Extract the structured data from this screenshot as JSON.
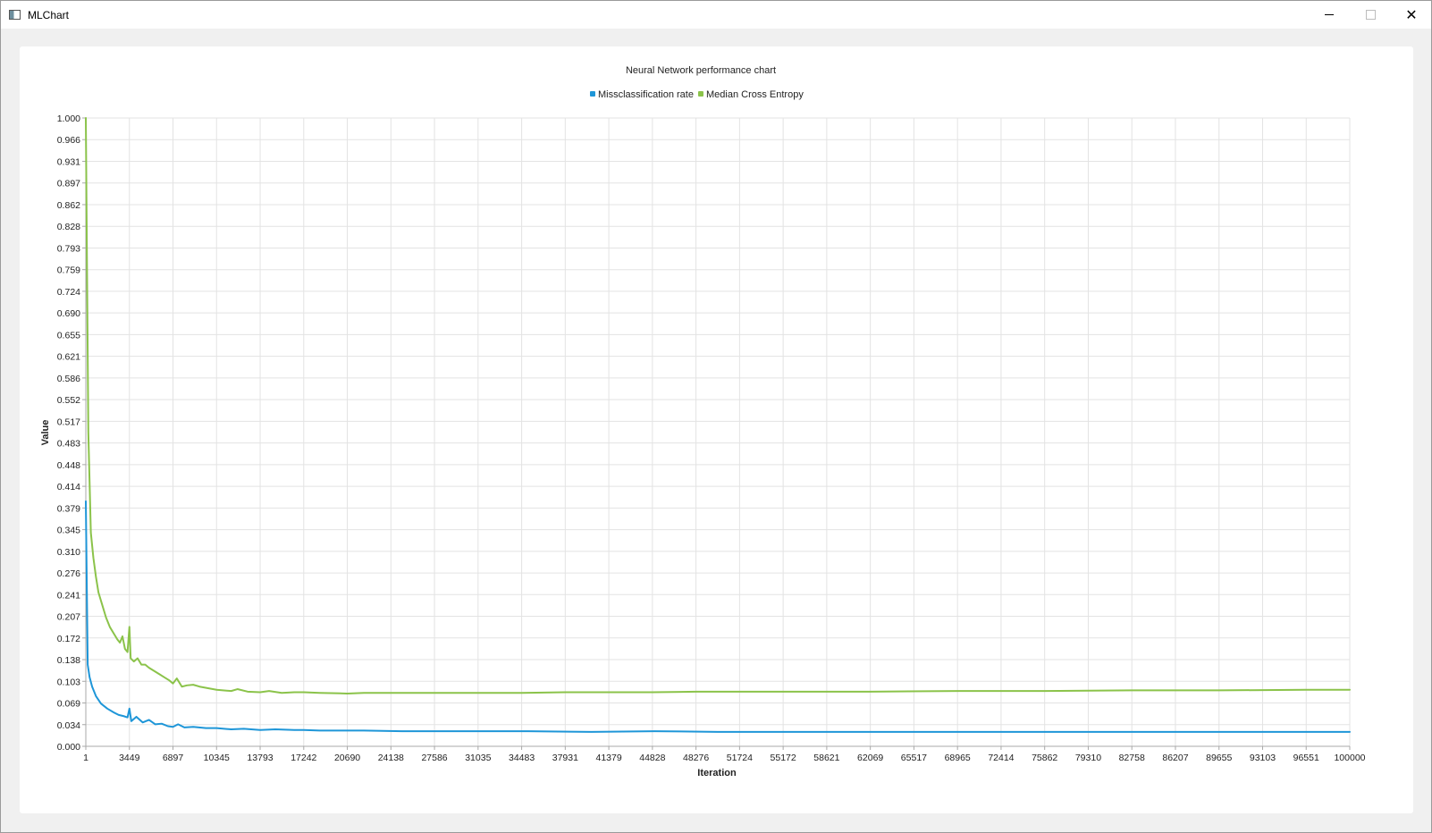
{
  "window": {
    "title": "MLChart",
    "icons": {
      "app": "app-window-icon",
      "minimize": "minimize-icon",
      "maximize": "maximize-icon",
      "close": "close-icon"
    },
    "close_glyph": "✕"
  },
  "colors": {
    "series1": "#1e96d8",
    "series2": "#8bc34a",
    "grid": "#e3e3e3",
    "axis": "#a8a8a8",
    "background": "#ffffff",
    "frame": "#f0f0f0"
  },
  "chart_data": {
    "type": "line",
    "title": "Neural Network performance chart",
    "xlabel": "Iteration",
    "ylabel": "Value",
    "xlim": [
      1,
      100000
    ],
    "ylim": [
      0,
      1
    ],
    "grid": true,
    "legend": "top-center",
    "x_ticks": [
      "1",
      "3449",
      "6897",
      "10345",
      "13793",
      "17242",
      "20690",
      "24138",
      "27586",
      "31035",
      "34483",
      "37931",
      "41379",
      "44828",
      "48276",
      "51724",
      "55172",
      "58621",
      "62069",
      "65517",
      "68965",
      "72414",
      "75862",
      "79310",
      "82758",
      "86207",
      "89655",
      "93103",
      "96551",
      "100000"
    ],
    "y_ticks": [
      "0.000",
      "0.034",
      "0.069",
      "0.103",
      "0.138",
      "0.172",
      "0.207",
      "0.241",
      "0.276",
      "0.310",
      "0.345",
      "0.379",
      "0.414",
      "0.448",
      "0.483",
      "0.517",
      "0.552",
      "0.586",
      "0.621",
      "0.655",
      "0.690",
      "0.724",
      "0.759",
      "0.793",
      "0.828",
      "0.862",
      "0.897",
      "0.931",
      "0.966",
      "1.000"
    ],
    "series": [
      {
        "name": "Missclassification rate",
        "x": [
          1,
          150,
          300,
          500,
          800,
          1200,
          1700,
          2200,
          2600,
          3000,
          3300,
          3449,
          3600,
          4000,
          4500,
          5000,
          5500,
          6000,
          6500,
          6897,
          7300,
          7800,
          8500,
          9500,
          10345,
          11500,
          12500,
          13793,
          15000,
          16500,
          17242,
          18500,
          20000,
          22000,
          25000,
          28000,
          31035,
          35000,
          40000,
          45000,
          50000,
          55000,
          60000,
          65000,
          70000,
          75000,
          80000,
          85000,
          90000,
          95000,
          100000
        ],
        "values": [
          0.39,
          0.13,
          0.11,
          0.095,
          0.08,
          0.068,
          0.06,
          0.054,
          0.05,
          0.048,
          0.046,
          0.06,
          0.04,
          0.047,
          0.038,
          0.042,
          0.035,
          0.036,
          0.032,
          0.031,
          0.035,
          0.03,
          0.031,
          0.029,
          0.029,
          0.027,
          0.028,
          0.026,
          0.027,
          0.026,
          0.026,
          0.025,
          0.025,
          0.025,
          0.024,
          0.024,
          0.024,
          0.024,
          0.023,
          0.024,
          0.023,
          0.023,
          0.023,
          0.023,
          0.023,
          0.023,
          0.023,
          0.023,
          0.023,
          0.023,
          0.023
        ]
      },
      {
        "name": "Median Cross Entropy",
        "x": [
          1,
          100,
          200,
          400,
          600,
          800,
          1000,
          1300,
          1600,
          1900,
          2200,
          2500,
          2700,
          2900,
          3100,
          3300,
          3449,
          3550,
          3800,
          4100,
          4400,
          4700,
          5000,
          5400,
          5800,
          6200,
          6600,
          6897,
          7200,
          7600,
          8000,
          8500,
          9000,
          10345,
          11500,
          12000,
          12800,
          13793,
          14500,
          15500,
          16500,
          17242,
          18500,
          20690,
          22000,
          24138,
          27586,
          31035,
          34483,
          37931,
          41379,
          44828,
          48276,
          55172,
          62069,
          68965,
          75862,
          82758,
          89655,
          96551,
          100000
        ],
        "values": [
          1.0,
          0.75,
          0.5,
          0.34,
          0.3,
          0.27,
          0.245,
          0.225,
          0.205,
          0.19,
          0.18,
          0.17,
          0.165,
          0.175,
          0.155,
          0.15,
          0.19,
          0.14,
          0.135,
          0.14,
          0.13,
          0.13,
          0.125,
          0.12,
          0.115,
          0.11,
          0.105,
          0.1,
          0.108,
          0.095,
          0.097,
          0.098,
          0.095,
          0.09,
          0.088,
          0.091,
          0.087,
          0.086,
          0.088,
          0.085,
          0.086,
          0.086,
          0.085,
          0.084,
          0.085,
          0.085,
          0.085,
          0.085,
          0.085,
          0.086,
          0.086,
          0.086,
          0.087,
          0.087,
          0.087,
          0.088,
          0.088,
          0.089,
          0.089,
          0.09,
          0.09
        ]
      }
    ]
  }
}
